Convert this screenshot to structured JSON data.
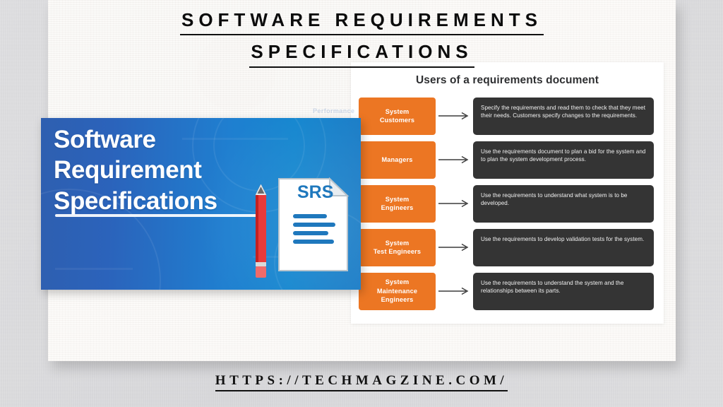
{
  "page": {
    "background_color": "#d9d9db",
    "paper_color": "#faf8f5"
  },
  "headline": {
    "line1": "SOFTWARE REQUIREMENTS",
    "line2": "SPECIFICATIONS"
  },
  "footer": {
    "url": "HTTPS://TECHMAGZINE.COM/"
  },
  "banner": {
    "title_line1": "Software",
    "title_line2": "Requirement",
    "title_line3": "Specifications",
    "doc_label": "SRS",
    "accent_color": "#1f7fd0",
    "ghost_text": "Performance"
  },
  "diagram": {
    "title": "Users of a requirements document",
    "role_color": "#ec7623",
    "desc_color": "#343434",
    "rows": [
      {
        "role": "System\nCustomers",
        "role_line1": "System",
        "role_line2": "Customers",
        "role_line3": "",
        "description": "Specify the requirements and read them to check that they meet their needs. Customers specify changes to the requirements."
      },
      {
        "role": "Managers",
        "role_line1": "Managers",
        "role_line2": "",
        "role_line3": "",
        "description": "Use the requirements document to plan a bid for the system and to plan the system development process."
      },
      {
        "role": "System\nEngineers",
        "role_line1": "System",
        "role_line2": "Engineers",
        "role_line3": "",
        "description": "Use the requirements to understand what system is to be developed."
      },
      {
        "role": "System\nTest Engineers",
        "role_line1": "System",
        "role_line2": "Test Engineers",
        "role_line3": "",
        "description": "Use the requirements to develop validation tests for the system."
      },
      {
        "role": "System\nMaintenance\nEngineers",
        "role_line1": "System",
        "role_line2": "Maintenance",
        "role_line3": "Engineers",
        "description": "Use the requirements to understand the system and the relationships between its parts."
      }
    ]
  }
}
